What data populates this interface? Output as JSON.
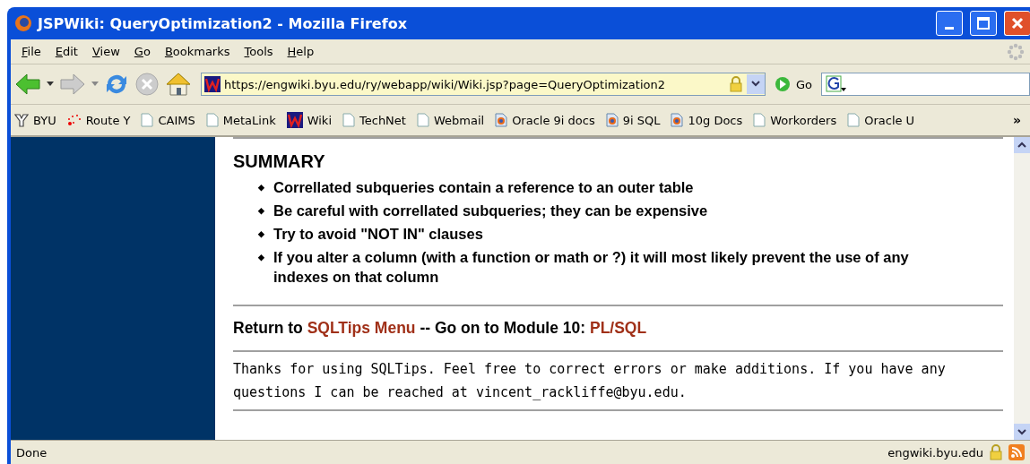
{
  "window": {
    "title": "JSPWiki: QueryOptimization2 - Mozilla Firefox"
  },
  "menu": [
    "File",
    "Edit",
    "View",
    "Go",
    "Bookmarks",
    "Tools",
    "Help"
  ],
  "address": {
    "value": "https://engwiki.byu.edu/ry/webapp/wiki/Wiki.jsp?page=QueryOptimization2"
  },
  "go_label": "Go",
  "bookmarks": [
    {
      "label": "BYU",
      "kind": "byu"
    },
    {
      "label": "Route Y",
      "kind": "dots"
    },
    {
      "label": "CAIMS",
      "kind": "page"
    },
    {
      "label": "MetaLink",
      "kind": "page"
    },
    {
      "label": "Wiki",
      "kind": "wiki"
    },
    {
      "label": "TechNet",
      "kind": "page"
    },
    {
      "label": "Webmail",
      "kind": "page"
    },
    {
      "label": "Oracle 9i docs",
      "kind": "firefox"
    },
    {
      "label": "9i SQL",
      "kind": "firefox"
    },
    {
      "label": "10g Docs",
      "kind": "firefox"
    },
    {
      "label": "Workorders",
      "kind": "page"
    },
    {
      "label": "Oracle U",
      "kind": "page"
    }
  ],
  "bookmarks_more": "»",
  "content": {
    "heading": "SUMMARY",
    "bullets": [
      {
        "marker": "◆",
        "text": "Correllated subqueries contain a reference to an outer table"
      },
      {
        "marker": "◆",
        "text": "Be careful with correllated subqueries; they can be expensive"
      },
      {
        "marker": "◆",
        "text": "Try to avoid \"NOT IN\" clauses"
      },
      {
        "marker": "◆",
        "text": "If you alter a column (with a function or math or ?) it will most likely prevent the use of any indexes on that column"
      }
    ],
    "nav": [
      {
        "text": "Return to ",
        "kind": "text"
      },
      {
        "text": "SQLTips Menu",
        "kind": "link"
      },
      {
        "text": " -- Go on to Module 10: ",
        "kind": "text"
      },
      {
        "text": "PL/SQL",
        "kind": "link"
      }
    ],
    "footer": "Thanks for using SQLTips. Feel free to correct errors or make additions. If you have any questions I can be reached at vincent_rackliffe@byu.edu."
  },
  "status_bar": {
    "text": "Done",
    "host": "engwiki.byu.edu"
  }
}
